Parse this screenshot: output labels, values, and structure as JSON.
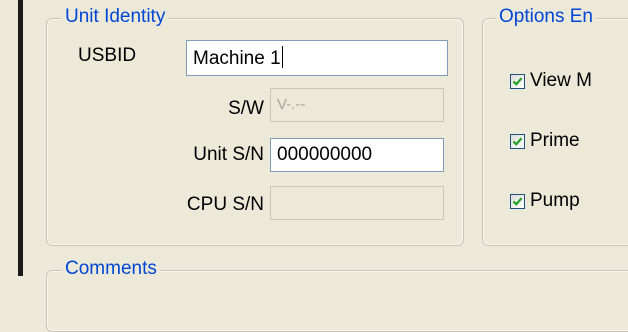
{
  "unit_identity": {
    "legend": "Unit Identity",
    "usbid_label": "USBID",
    "usbid_value": "Machine 1",
    "sw_label": "S/W",
    "sw_value": "V-.--",
    "unit_sn_label": "Unit S/N",
    "unit_sn_value": "000000000",
    "cpu_sn_label": "CPU S/N",
    "cpu_sn_value": ""
  },
  "options": {
    "legend": "Options En",
    "items": [
      {
        "label": "View M",
        "checked": true
      },
      {
        "label": "Prime",
        "checked": true
      },
      {
        "label": "Pump",
        "checked": true
      }
    ]
  },
  "comments": {
    "legend": "Comments"
  },
  "colors": {
    "background": "#ece9d8",
    "legend_text": "#0046d5",
    "check_mark": "#21a121"
  }
}
